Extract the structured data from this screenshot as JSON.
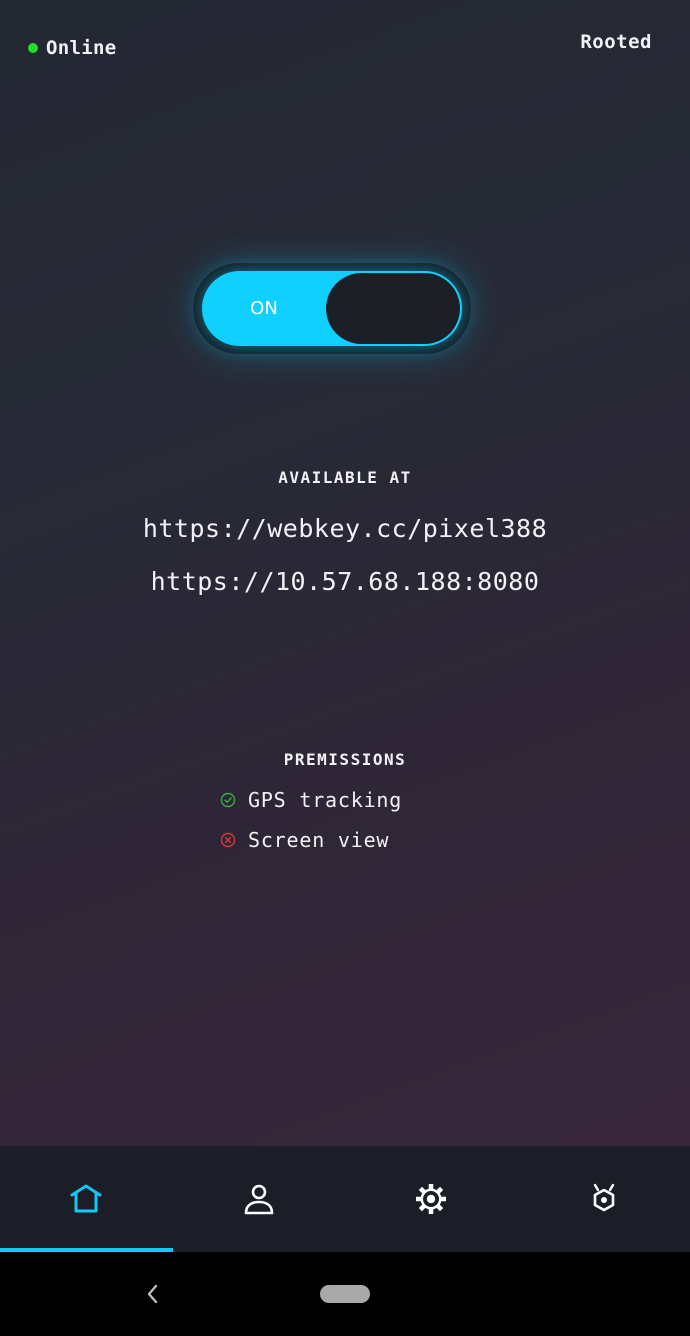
{
  "status": {
    "online_label": "Online",
    "online_color": "#22dd2a",
    "rooted_label": "Rooted"
  },
  "toggle": {
    "label": "ON",
    "state": "on",
    "accent_color": "#0fd0ff"
  },
  "available": {
    "title": "AVAILABLE AT",
    "urls": [
      "https://webkey.cc/pixel388",
      "https://10.57.68.188:8080"
    ]
  },
  "permissions": {
    "title": "PREMISSIONS",
    "items": [
      {
        "label": "GPS tracking",
        "granted": true,
        "icon": "check-circle-icon",
        "color": "#3fae3f"
      },
      {
        "label": "Screen view",
        "granted": false,
        "icon": "x-circle-icon",
        "color": "#d9383c"
      }
    ]
  },
  "tabs": [
    {
      "name": "home",
      "icon": "home-icon",
      "active": true
    },
    {
      "name": "account",
      "icon": "user-icon",
      "active": false
    },
    {
      "name": "settings",
      "icon": "gear-icon",
      "active": false
    },
    {
      "name": "other",
      "icon": "hexagon-icon",
      "active": false
    }
  ],
  "colors": {
    "accent": "#14c8f5",
    "tab_icon": "#ffffff"
  }
}
